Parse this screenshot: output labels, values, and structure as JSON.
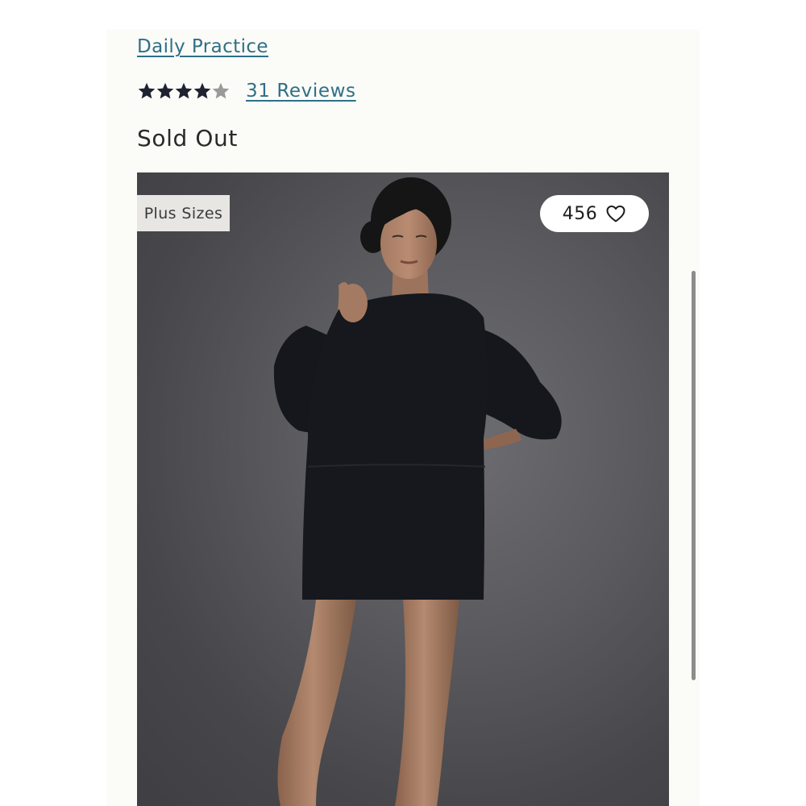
{
  "product": {
    "brand_link": "Daily Practice",
    "rating": {
      "value": 4,
      "max": 5
    },
    "reviews_link": "31 Reviews",
    "availability": "Sold Out"
  },
  "image": {
    "badge": "Plus Sizes",
    "favorites_count": "456",
    "icons": {
      "favorite": "heart-outline-icon",
      "star": "star-icon"
    }
  },
  "colors": {
    "link": "#2f6f86",
    "star_filled": "#1f2230",
    "star_empty": "#9a9a9a",
    "page_background": "#fbfbf8"
  }
}
